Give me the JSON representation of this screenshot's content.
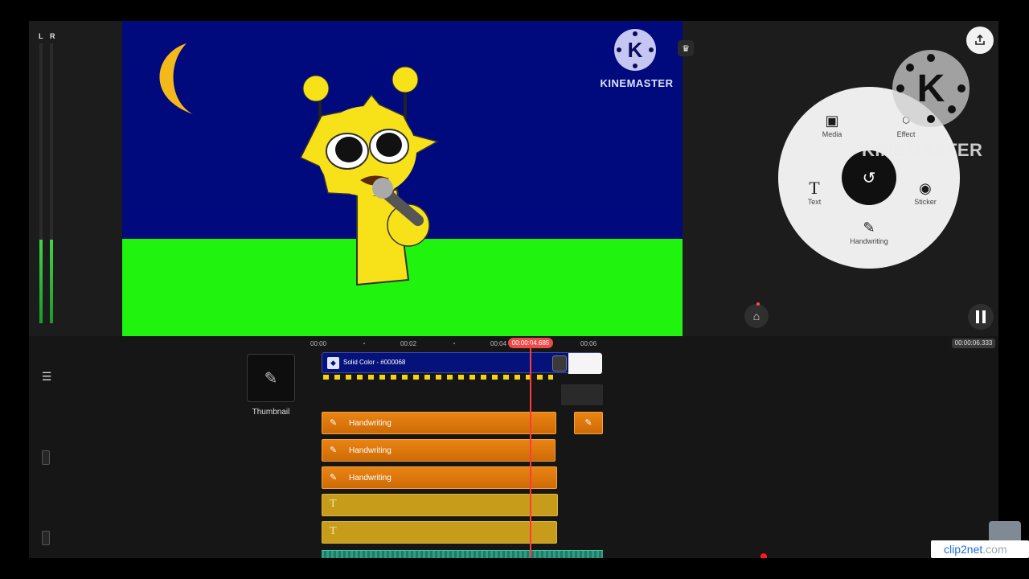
{
  "meters": {
    "left_label": "L",
    "right_label": "R",
    "left_level": 0.3,
    "right_level": 0.3
  },
  "preview": {
    "watermark_text": "KINEMASTER",
    "watermark_logo_letter": "K",
    "premium_icon": "crown-icon"
  },
  "right_panel": {
    "export_icon": "upload-icon",
    "logo_letter": "K",
    "logo_text": "KINEMASTER",
    "wheel": {
      "center_icon": "undo-icon",
      "items": [
        {
          "label": "Media",
          "icon": "image-icon"
        },
        {
          "label": "Effect",
          "icon": "fx-icon"
        },
        {
          "label": "Text",
          "icon": "text-icon"
        },
        {
          "label": "Sticker",
          "icon": "sticker-icon"
        },
        {
          "label": "Handwriting",
          "icon": "pen-icon"
        }
      ]
    },
    "asset_store_icon": "store-icon",
    "pause_icon": "pause-icon"
  },
  "timeline": {
    "ticks": [
      "00:00",
      "00:02",
      "00:04",
      "00:06"
    ],
    "current_time": "00:00:04.685",
    "total_time": "00:00:06.333",
    "thumbnail_label": "Thumbnail",
    "main_clip_label": "Solid Color - #000068",
    "layers": [
      {
        "type": "handwriting",
        "label": "Handwriting"
      },
      {
        "type": "handwriting",
        "label": "Handwriting"
      },
      {
        "type": "handwriting",
        "label": "Handwriting"
      },
      {
        "type": "text",
        "label": ""
      },
      {
        "type": "text",
        "label": ""
      }
    ]
  },
  "overlay": {
    "clip2net_main": "clip2net",
    "clip2net_tail": ".com"
  },
  "colors": {
    "sky": "#000a7c",
    "ground": "#1ff30e",
    "handwriting_clip": "#e88513",
    "text_clip": "#c79c1a",
    "playhead": "#ff3b3b"
  }
}
